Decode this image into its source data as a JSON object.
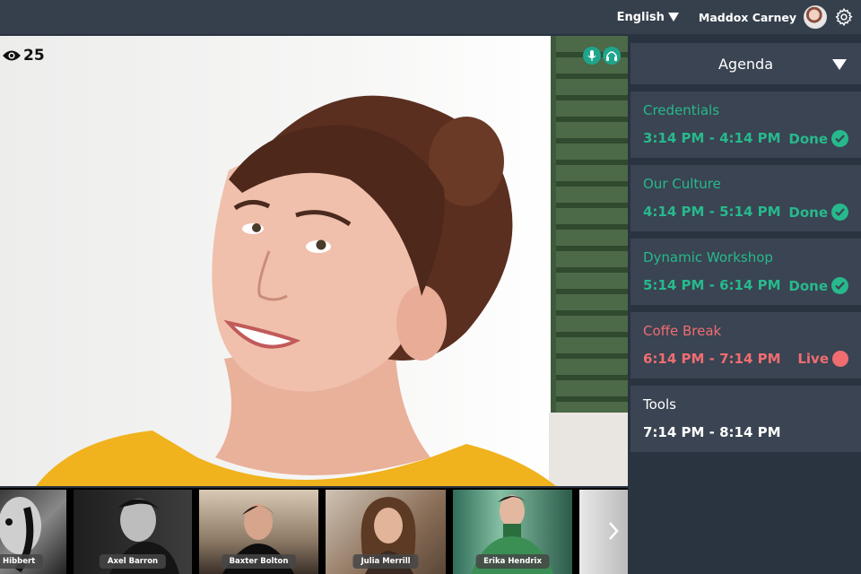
{
  "header": {
    "language": "English",
    "user_name": "Maddox Carney"
  },
  "stage": {
    "viewer_count": "25"
  },
  "participants": [
    {
      "name": "Hibbert"
    },
    {
      "name": "Axel Barron"
    },
    {
      "name": "Baxter Bolton"
    },
    {
      "name": "Julia Merrill"
    },
    {
      "name": "Erika Hendrix"
    }
  ],
  "agenda": {
    "title": "Agenda",
    "items": [
      {
        "title": "Credentials",
        "time": "3:14 PM - 4:14 PM",
        "status": "Done"
      },
      {
        "title": "Our Culture",
        "time": "4:14 PM - 5:14 PM",
        "status": "Done"
      },
      {
        "title": "Dynamic Workshop",
        "time": "5:14 PM - 6:14 PM",
        "status": "Done"
      },
      {
        "title": "Coffe Break",
        "time": "6:14 PM - 7:14 PM",
        "status": "Live"
      },
      {
        "title": "Tools",
        "time": "7:14 PM - 8:14 PM",
        "status": ""
      }
    ]
  },
  "colors": {
    "done": "#27b98c",
    "live": "#ef6d71",
    "panel": "#3a4452",
    "background": "#2a3340"
  },
  "icons": [
    "eye-icon",
    "microphone-icon",
    "headphones-icon",
    "gear-icon",
    "chevron-right-icon",
    "check-icon",
    "live-dot-icon",
    "caret-down-icon"
  ]
}
